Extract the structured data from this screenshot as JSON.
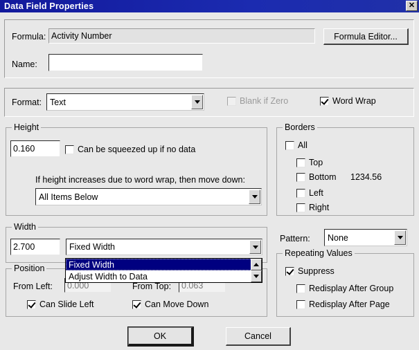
{
  "window": {
    "title": "Data Field Properties",
    "close_label": "✕"
  },
  "top_section": {
    "formula_label": "Formula:",
    "formula_value": "Activity Number",
    "formula_editor_button": "Formula Editor...",
    "name_label": "Name:",
    "name_value": ""
  },
  "format_section": {
    "format_label": "Format:",
    "format_value": "Text",
    "blank_if_zero_label": "Blank if Zero",
    "blank_if_zero_checked": false,
    "blank_if_zero_disabled": true,
    "word_wrap_label": "Word Wrap",
    "word_wrap_checked": true
  },
  "height_group": {
    "title": "Height",
    "value": "0.160",
    "squeeze_label": "Can be squeezed up if no data",
    "squeeze_checked": false,
    "move_down_label": "If height increases due to word wrap, then move down:",
    "move_down_value": "All Items Below"
  },
  "borders_group": {
    "title": "Borders",
    "all_label": "All",
    "top_label": "Top",
    "bottom_label": "Bottom",
    "left_label": "Left",
    "right_label": "Right",
    "sample_value": "1234.56"
  },
  "width_group": {
    "title": "Width",
    "value": "2.700",
    "mode_value": "Fixed Width",
    "options": [
      {
        "label": "Fixed Width",
        "selected": true
      },
      {
        "label": "Adjust Width to Data",
        "selected": false
      }
    ],
    "scroll_up_icon": "scroll-up-arrow",
    "scroll_down_icon": "scroll-down-arrow"
  },
  "position_group": {
    "title": "Position",
    "from_left_label": "From Left:",
    "from_left_value": "0.000",
    "from_top_label": "From Top:",
    "from_top_value": "0.063",
    "can_slide_left_label": "Can Slide Left",
    "can_slide_left_checked": true,
    "can_move_down_label": "Can Move Down",
    "can_move_down_checked": true
  },
  "pattern": {
    "label": "Pattern:",
    "value": "None"
  },
  "repeating_values_group": {
    "title": "Repeating Values",
    "suppress_label": "Suppress",
    "suppress_checked": true,
    "redisplay_group_label": "Redisplay After Group",
    "redisplay_group_checked": false,
    "redisplay_page_label": "Redisplay After Page",
    "redisplay_page_checked": false
  },
  "footer": {
    "ok_label": "OK",
    "cancel_label": "Cancel"
  }
}
